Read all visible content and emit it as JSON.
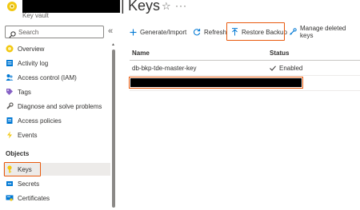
{
  "header": {
    "separator": "|",
    "title": "Keys",
    "resource_type": "Key vault"
  },
  "sidebar": {
    "search_placeholder": "Search",
    "items": [
      {
        "label": "Overview",
        "icon": "overview-icon"
      },
      {
        "label": "Activity log",
        "icon": "activity-log-icon"
      },
      {
        "label": "Access control (IAM)",
        "icon": "iam-icon"
      },
      {
        "label": "Tags",
        "icon": "tag-icon"
      },
      {
        "label": "Diagnose and solve problems",
        "icon": "wrench-icon"
      },
      {
        "label": "Access policies",
        "icon": "access-policies-icon"
      },
      {
        "label": "Events",
        "icon": "lightning-icon"
      }
    ],
    "section_objects": "Objects",
    "objects": [
      {
        "label": "Keys",
        "icon": "key-icon",
        "active": true
      },
      {
        "label": "Secrets",
        "icon": "secrets-icon"
      },
      {
        "label": "Certificates",
        "icon": "certificate-icon"
      }
    ]
  },
  "toolbar": {
    "generate_import": "Generate/Import",
    "refresh": "Refresh",
    "restore_backup": "Restore Backup",
    "manage_deleted": "Manage deleted keys"
  },
  "grid": {
    "columns": [
      "Name",
      "Status"
    ],
    "rows": [
      {
        "name": "db-bkp-tde-master-key",
        "status": "Enabled"
      }
    ]
  },
  "colors": {
    "highlight": "#e8590c",
    "accent": "#0078d4",
    "active_bg": "#edebe9"
  }
}
